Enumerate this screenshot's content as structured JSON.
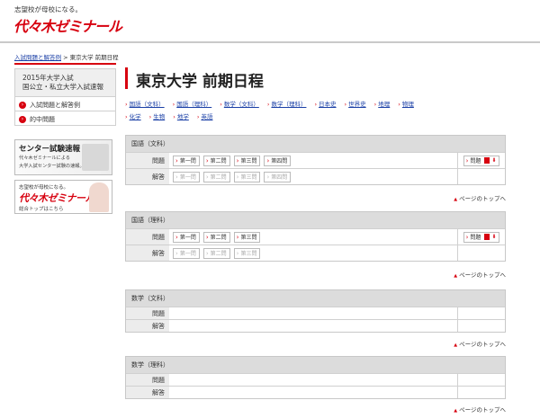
{
  "header": {
    "tagline": "志望校が母校になる。",
    "logo": "代々木ゼミナール"
  },
  "breadcrumb": {
    "link": "入試問題と解答例",
    "sep": ">",
    "current": "東京大学 前期日程"
  },
  "sidebar": {
    "heading_line1": "2015年大学入試",
    "heading_line2": "国公立・私立大学入試速報",
    "items": [
      {
        "label": "入試問題と解答例",
        "icon": "›"
      },
      {
        "label": "的中問題",
        "icon": "›"
      }
    ],
    "banner1": {
      "title": "センター試験速報",
      "line1": "代々木ゼミナールによる",
      "line2": "大学入試センター試験の速報。"
    },
    "banner2": {
      "tagline": "志望校が母校になる。",
      "logo": "代々木ゼミナール",
      "bottom": "総合トップはこちら"
    }
  },
  "main": {
    "title": "東京大学 前期日程",
    "subjects": [
      "国語（文科）",
      "国語（理科）",
      "数学（文科）",
      "数学（理科）",
      "日本史",
      "世界史",
      "地理",
      "物理",
      "化学",
      "生物",
      "地学",
      "英語"
    ],
    "row_label_problem": "問題",
    "row_label_answer": "解答",
    "pagetop": "ページのトップへ",
    "side_button": "問題",
    "sections": [
      {
        "title": "国語（文科）",
        "problems": [
          "第一問",
          "第二問",
          "第三問",
          "第四問"
        ]
      },
      {
        "title": "国語（理科）",
        "problems": [
          "第一問",
          "第二問",
          "第三問"
        ]
      },
      {
        "title": "数学（文科）",
        "problems": []
      },
      {
        "title": "数学（理科）",
        "problems": []
      }
    ]
  },
  "colors": {
    "accent": "#d7000f",
    "link": "#1a3fa6"
  }
}
